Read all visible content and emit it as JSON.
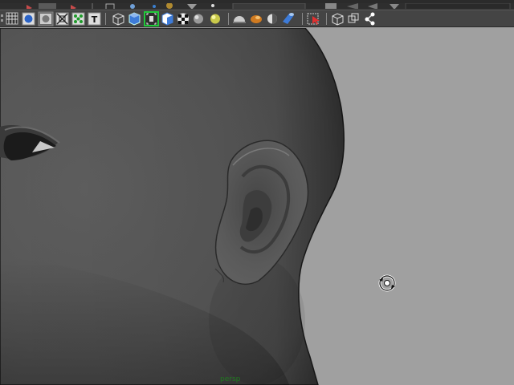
{
  "toolbar": {
    "icons": [
      "wireframe-icon",
      "smooth-shade-icon",
      "default-material-icon",
      "xray-icon",
      "component-xray-icon",
      "texture-icon",
      "cube-wire-icon",
      "cube-shaded-icon",
      "isolate-select-icon",
      "cube-bounding-icon",
      "checker-icon",
      "sphere-shade-icon",
      "light-dome-icon",
      "default-light-icon",
      "shadow-icon",
      "material-icon",
      "ambient-occlusion-icon",
      "select-camera-icon",
      "frame-icon",
      "frame-selection-icon",
      "node-graph-icon"
    ]
  },
  "viewport": {
    "camera": "persp",
    "background_color": "#a0a0a0",
    "model_color": "#5c5c5c"
  },
  "colors": {
    "camera_label": "#1f7a1f",
    "highlight": "#21c83a"
  }
}
